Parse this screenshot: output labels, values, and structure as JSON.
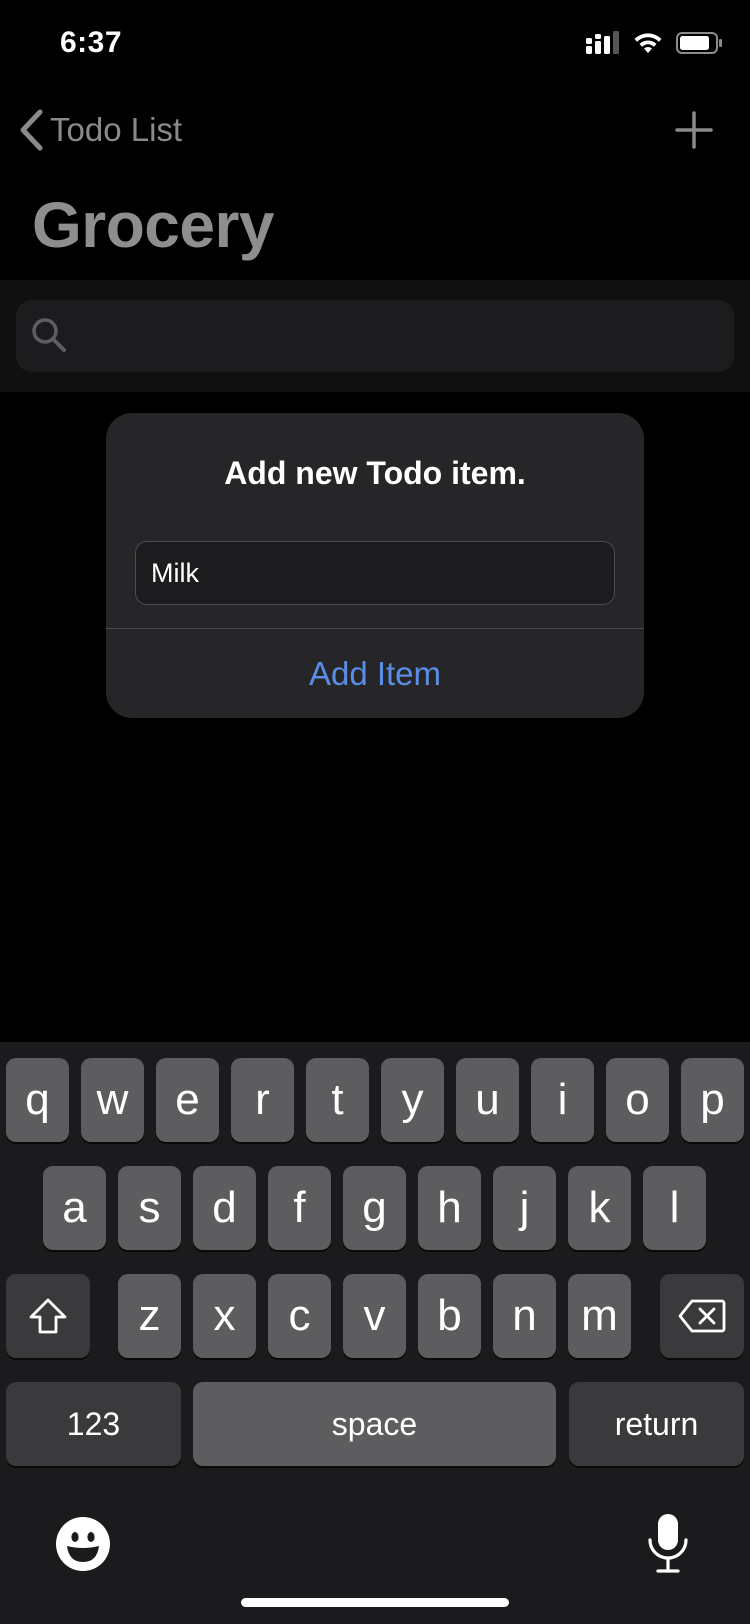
{
  "status_bar": {
    "time": "6:37"
  },
  "nav": {
    "back_label": "Todo List",
    "title": "Grocery"
  },
  "search": {
    "placeholder": ""
  },
  "alert": {
    "title": "Add new Todo item.",
    "input_value": "Milk",
    "action_label": "Add Item"
  },
  "keyboard": {
    "row1": [
      "q",
      "w",
      "e",
      "r",
      "t",
      "y",
      "u",
      "i",
      "o",
      "p"
    ],
    "row2": [
      "a",
      "s",
      "d",
      "f",
      "g",
      "h",
      "j",
      "k",
      "l"
    ],
    "row3": [
      "z",
      "x",
      "c",
      "v",
      "b",
      "n",
      "m"
    ],
    "numbers_label": "123",
    "space_label": "space",
    "return_label": "return"
  },
  "colors": {
    "accent": "#5a8ee6",
    "background": "#000000",
    "keyboard_bg": "#1b1b1d"
  }
}
